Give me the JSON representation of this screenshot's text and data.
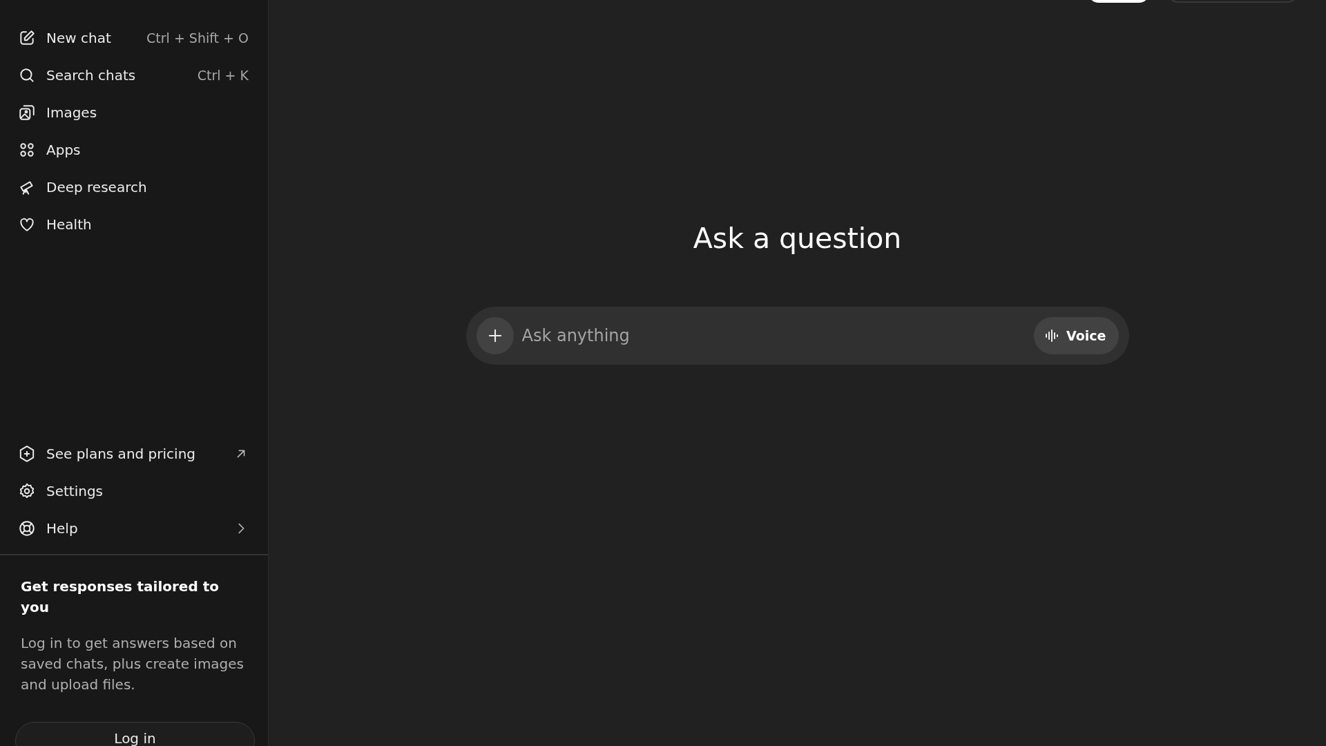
{
  "sidebar": {
    "nav_items": [
      {
        "label": "New chat",
        "shortcut": "Ctrl + Shift + O"
      },
      {
        "label": "Search chats",
        "shortcut": "Ctrl + K"
      },
      {
        "label": "Images"
      },
      {
        "label": "Apps"
      },
      {
        "label": "Deep research"
      },
      {
        "label": "Health"
      }
    ],
    "footer_items": [
      {
        "label": "See plans and pricing",
        "kind": "external"
      },
      {
        "label": "Settings",
        "kind": "plain"
      },
      {
        "label": "Help",
        "kind": "submenu"
      }
    ],
    "promo": {
      "title": "Get responses tailored to you",
      "text": "Log in to get answers based on saved chats, plus create images and upload files.",
      "button": "Log in"
    }
  },
  "main": {
    "heading": "Ask a question",
    "composer": {
      "placeholder": "Ask anything",
      "voice_button": "Voice"
    }
  }
}
